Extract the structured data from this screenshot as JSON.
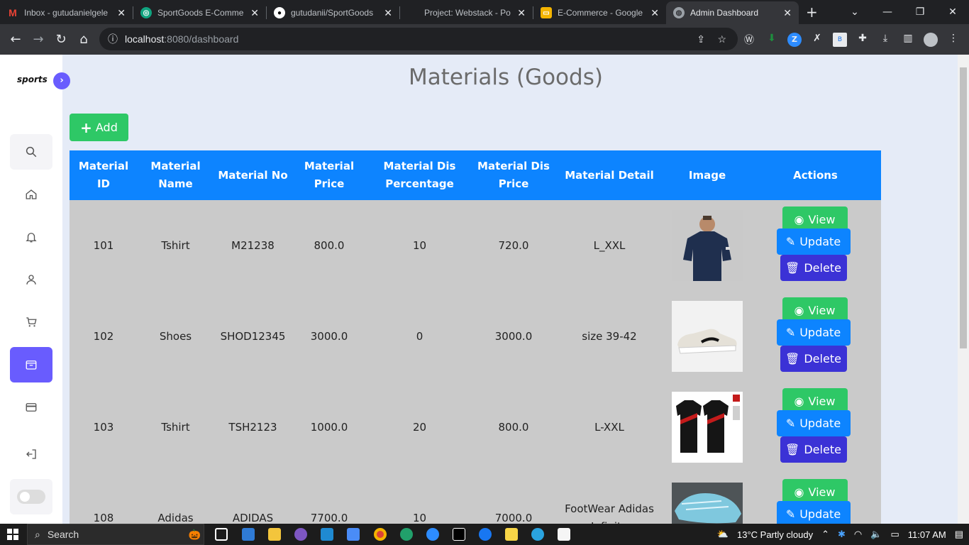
{
  "browser": {
    "tabs": [
      {
        "title": "Inbox - gutudanielgele",
        "icon_color": "#ea4335",
        "icon_letter": "M"
      },
      {
        "title": "SportGoods E-Comme",
        "icon_color": "#10a37f",
        "icon_letter": "◎"
      },
      {
        "title": "gutudanii/SportGoods",
        "icon_color": "#ffffff",
        "icon_letter": "●"
      },
      {
        "title": "Project: Webstack - Po",
        "icon_color": "#202124",
        "icon_letter": ""
      },
      {
        "title": "E-Commerce - Google",
        "icon_color": "#f4b400",
        "icon_letter": "▭"
      },
      {
        "title": "Admin Dashboard",
        "icon_color": "#9aa0a6",
        "icon_letter": "◍"
      }
    ],
    "active_tab_index": 5,
    "url_host": "localhost",
    "url_path": ":8080/dashboard"
  },
  "sidebar": {
    "logo": "sports",
    "items": [
      "search-icon",
      "home-icon",
      "bell-icon",
      "user-icon",
      "cart-icon",
      "materials-icon",
      "card-icon",
      "logout-icon"
    ],
    "active_item": "materials-icon"
  },
  "page": {
    "title": "Materials (Goods)",
    "add_label": "Add"
  },
  "table": {
    "headers": [
      "Material ID",
      "Material Name",
      "Material No",
      "Material Price",
      "Material Dis Percentage",
      "Material Dis Price",
      "Material Detail",
      "Image",
      "Actions"
    ],
    "rows": [
      {
        "id": "101",
        "name": "Tshirt",
        "no": "M21238",
        "price": "800.0",
        "dis_pct": "10",
        "dis_price": "720.0",
        "detail": "L_XXL"
      },
      {
        "id": "102",
        "name": "Shoes",
        "no": "SHOD12345",
        "price": "3000.0",
        "dis_pct": "0",
        "dis_price": "3000.0",
        "detail": "size 39-42"
      },
      {
        "id": "103",
        "name": "Tshirt",
        "no": "TSH2123",
        "price": "1000.0",
        "dis_pct": "20",
        "dis_price": "800.0",
        "detail": "L-XXL"
      },
      {
        "id": "108",
        "name": "Adidas",
        "no": "ADIDAS",
        "price": "7700.0",
        "dis_pct": "10",
        "dis_price": "7000.0",
        "detail": "FootWear Adidas Infinito"
      }
    ],
    "actions": {
      "view": "View",
      "update": "Update",
      "delete": "Delete"
    }
  },
  "taskbar": {
    "search_placeholder": "Search",
    "weather": "13°C  Partly cloudy",
    "time": "11:07 AM"
  },
  "colors": {
    "primary": "#0d84ff",
    "success": "#2ec866",
    "danger_indigo": "#3b32d6",
    "sidebar_accent": "#695cfe",
    "row_bg": "#cacaca"
  }
}
